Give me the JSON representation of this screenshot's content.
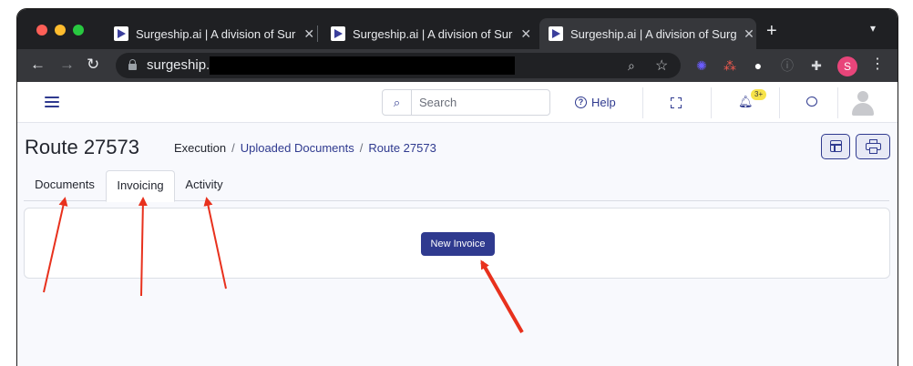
{
  "browser": {
    "tabs": [
      {
        "title": "Surgeship.ai | A division of Surgeship",
        "active": false
      },
      {
        "title": "Surgeship.ai | A division of Surgeship",
        "active": false
      },
      {
        "title": "Surgeship.ai | A division of Surgeship",
        "active": true
      }
    ],
    "new_tab_label": "+",
    "url": "surgeship.",
    "profile_initial": "S"
  },
  "app": {
    "search_placeholder": "Search",
    "help_label": "Help",
    "notification_count": "3+"
  },
  "page": {
    "title": "Route 27573",
    "breadcrumb": {
      "root": "Execution",
      "separator": "/",
      "parent": "Uploaded Documents",
      "current": "Route 27573"
    },
    "tabs": [
      {
        "label": "Documents",
        "active": false
      },
      {
        "label": "Invoicing",
        "active": true
      },
      {
        "label": "Activity",
        "active": false
      }
    ],
    "new_invoice_label": "New Invoice"
  },
  "colors": {
    "brand": "#2f3a8f",
    "annotation_arrow": "#e8311d"
  }
}
